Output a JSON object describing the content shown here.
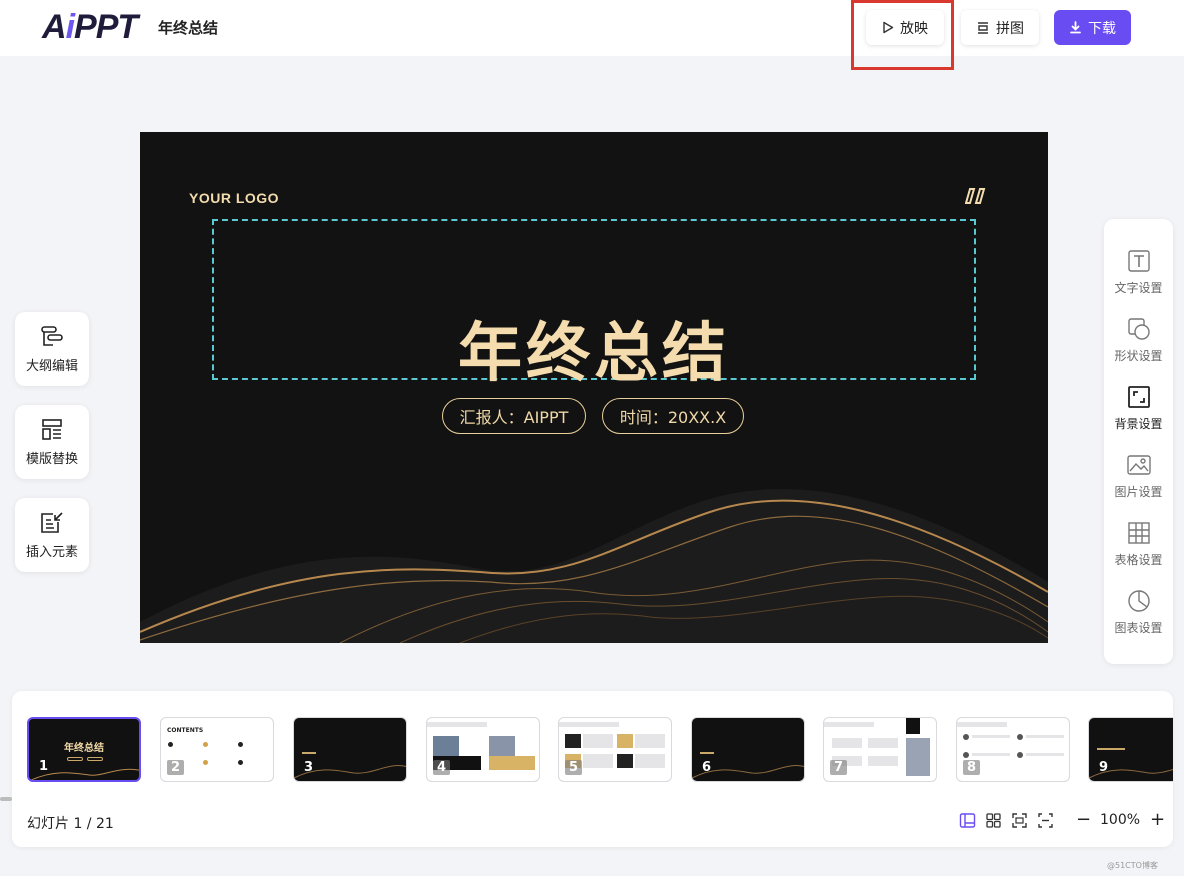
{
  "header": {
    "logo_prefix": "A",
    "logo_accent": "i",
    "logo_suffix": "PPT",
    "doc_title": "年终总结",
    "play_label": "放映",
    "pin_label": "拼图",
    "download_label": "下载"
  },
  "slide": {
    "logo_text": "YOUR LOGO",
    "quote_mark": "〃",
    "title": "年终总结",
    "reporter": "汇报人：AIPPT",
    "time": "时间：20XX.X"
  },
  "left_tools": [
    {
      "label": "大纲编辑",
      "icon": "outline-icon"
    },
    {
      "label": "模版替换",
      "icon": "template-icon"
    },
    {
      "label": "插入元素",
      "icon": "insert-icon"
    }
  ],
  "right_tools": [
    {
      "label": "文字设置",
      "icon": "text-icon"
    },
    {
      "label": "形状设置",
      "icon": "shape-icon"
    },
    {
      "label": "背景设置",
      "icon": "background-icon"
    },
    {
      "label": "图片设置",
      "icon": "image-icon"
    },
    {
      "label": "表格设置",
      "icon": "table-icon"
    },
    {
      "label": "图表设置",
      "icon": "chart-icon"
    }
  ],
  "thumbnails": [
    {
      "num": "1",
      "theme": "dark",
      "title": "年终总结"
    },
    {
      "num": "2",
      "theme": "light",
      "title": "CONTENTS"
    },
    {
      "num": "3",
      "theme": "dark",
      "title": ""
    },
    {
      "num": "4",
      "theme": "light",
      "title": ""
    },
    {
      "num": "5",
      "theme": "light",
      "title": ""
    },
    {
      "num": "6",
      "theme": "dark",
      "title": ""
    },
    {
      "num": "7",
      "theme": "light",
      "title": ""
    },
    {
      "num": "8",
      "theme": "light",
      "title": ""
    },
    {
      "num": "9",
      "theme": "dark",
      "title": ""
    }
  ],
  "footer": {
    "slide_counter": "幻灯片  1 / 21",
    "zoom": "100%",
    "zoom_minus": "−",
    "zoom_plus": "+"
  },
  "watermark": "@51CTO博客",
  "colors": {
    "accent": "#6a4df2",
    "gold": "#f4dcae",
    "highlight": "#d9382f"
  }
}
